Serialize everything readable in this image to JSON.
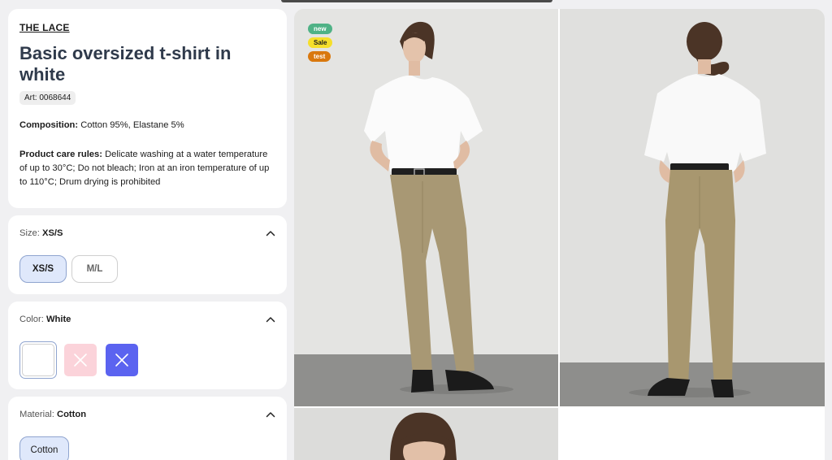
{
  "product": {
    "brand": "THE LACE",
    "title": "Basic oversized t-shirt in white",
    "art": "Art: 0068644",
    "composition_label": "Composition:",
    "composition_value": "Cotton 95%, Elastane 5%",
    "care_label": "Product care rules:",
    "care_value": "Delicate washing at a water temperature of up to 30°C; Do not bleach; Iron at an iron temperature of up to 110°C; Drum drying is prohibited"
  },
  "size": {
    "label": "Size:",
    "selected": "XS/S",
    "options": [
      "XS/S",
      "M/L"
    ]
  },
  "color": {
    "label": "Color:",
    "selected": "White",
    "swatches": [
      {
        "name": "White",
        "hex": "#ffffff",
        "available": true
      },
      {
        "name": "Pink",
        "hex": "#fbd3da",
        "available": false
      },
      {
        "name": "Blue",
        "hex": "#5b63f0",
        "available": false
      }
    ]
  },
  "material": {
    "label": "Material:",
    "selected": "Cotton",
    "options": [
      "Cotton"
    ]
  },
  "badges": [
    {
      "text": "new",
      "bg": "#4fb286",
      "fg": "#ffffff"
    },
    {
      "text": "Sale",
      "bg": "#f6df2a",
      "fg": "#1c1c1c"
    },
    {
      "text": "test",
      "bg": "#d9780d",
      "fg": "#ffffff"
    }
  ],
  "colors": {
    "title": "#2f3a4b",
    "accent_border": "#8fa4cf",
    "accent_bg": "#dfe8fb"
  }
}
